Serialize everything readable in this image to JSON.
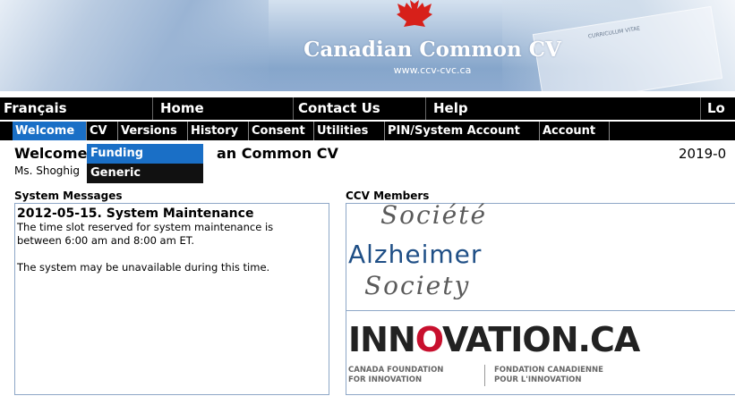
{
  "banner": {
    "title": "Canadian Common CV",
    "url": "www.ccv-cvc.ca"
  },
  "main_nav": [
    {
      "label": "Français"
    },
    {
      "label": "Home"
    },
    {
      "label": "Contact Us"
    },
    {
      "label": "Help"
    },
    {
      "label": "Lo"
    }
  ],
  "sub_nav": [
    {
      "label": "Welcome",
      "active": true
    },
    {
      "label": "CV"
    },
    {
      "label": "Versions"
    },
    {
      "label": "History"
    },
    {
      "label": "Consent"
    },
    {
      "label": "Utilities"
    },
    {
      "label": "PIN/System Account"
    },
    {
      "label": "Account"
    }
  ],
  "dropdown": [
    {
      "label": "Funding",
      "highlighted": true
    },
    {
      "label": "Generic"
    }
  ],
  "page": {
    "heading_left": "Welcome",
    "heading_right": "an Common CV",
    "date": "2019-0",
    "user_name": "Ms. Shoghig"
  },
  "system_messages": {
    "label": "System Messages",
    "title": "2012-05-15. System Maintenance",
    "line1": "The time slot reserved for system maintenance is",
    "line2": "between 6:00 am and 8:00 am ET.",
    "line3": "The system may be unavailable during this time."
  },
  "members": {
    "label": "CCV Members",
    "alz_fr": "Société",
    "alz_en": "Alzheimer",
    "alz_fr2": "Society",
    "innov_pre": "INN",
    "innov_o": "O",
    "innov_post": "VATION.CA",
    "innov_en1": "CANADA FOUNDATION",
    "innov_en2": "FOR INNOVATION",
    "innov_fr1": "FONDATION CANADIENNE",
    "innov_fr2": "POUR L'INNOVATION"
  },
  "colors": {
    "nav_bg": "#000000",
    "active_tab": "#1a6fc6",
    "box_border": "#8ea7c7",
    "alz_blue": "#1f4f86",
    "innov_red": "#c8102e"
  }
}
